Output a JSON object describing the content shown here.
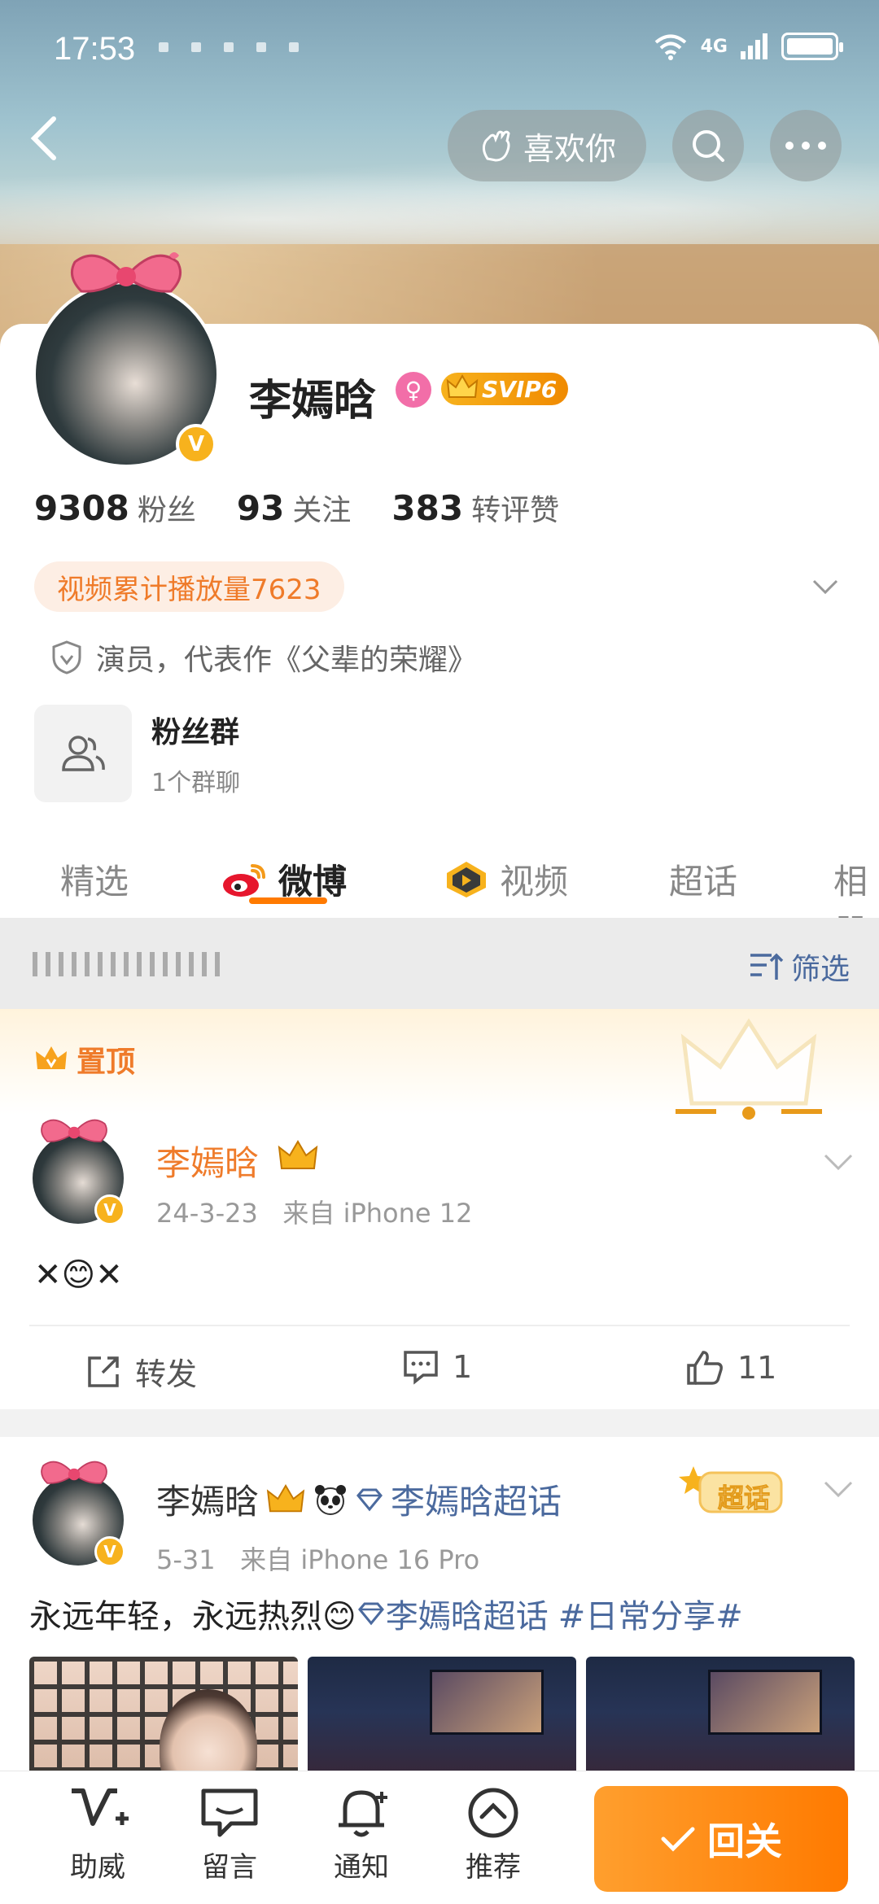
{
  "status_bar": {
    "time": "17:53",
    "network": "4G"
  },
  "top_nav": {
    "like_label": "喜欢你"
  },
  "profile": {
    "name": "李嫣晗",
    "svip_label": "SVIP6",
    "stats": [
      {
        "value": "9308",
        "label": "粉丝"
      },
      {
        "value": "93",
        "label": "关注"
      },
      {
        "value": "383",
        "label": "转评赞"
      }
    ],
    "video_plays": "视频累计播放量7623",
    "bio": "演员，代表作《父辈的荣耀》",
    "fan_group": {
      "title": "粉丝群",
      "subtitle": "1个群聊"
    }
  },
  "tabs": [
    {
      "label": "精选"
    },
    {
      "label": "微博",
      "active": true
    },
    {
      "label": "视频"
    },
    {
      "label": "超话"
    },
    {
      "label": "相册"
    }
  ],
  "filter": {
    "label": "筛选"
  },
  "posts": [
    {
      "pinned_label": "置顶",
      "author": "李嫣晗",
      "date": "24-3-23",
      "source": "来自 iPhone 12",
      "text": "✕😊✕",
      "actions": {
        "repost": "转发",
        "comments": "1",
        "likes": "11"
      }
    },
    {
      "author": "李嫣晗",
      "topic_tag": "李嫣晗超话",
      "badge": "超话",
      "date": "5-31",
      "source": "来自 iPhone 16 Pro",
      "text_main": "永远年轻，永远热烈😊",
      "text_topic": "李嫣晗超话",
      "text_hashtag": "#日常分享#"
    }
  ],
  "bottom_bar": {
    "items": [
      {
        "label": "助威",
        "icon": "cheer-icon"
      },
      {
        "label": "留言",
        "icon": "message-icon"
      },
      {
        "label": "通知",
        "icon": "bell-icon"
      },
      {
        "label": "推荐",
        "icon": "recommend-icon"
      }
    ],
    "follow_back_label": "回关"
  },
  "colors": {
    "accent": "#ff7a00",
    "vip_gold": "#f7b21d",
    "link_blue": "#4b6a9e"
  }
}
